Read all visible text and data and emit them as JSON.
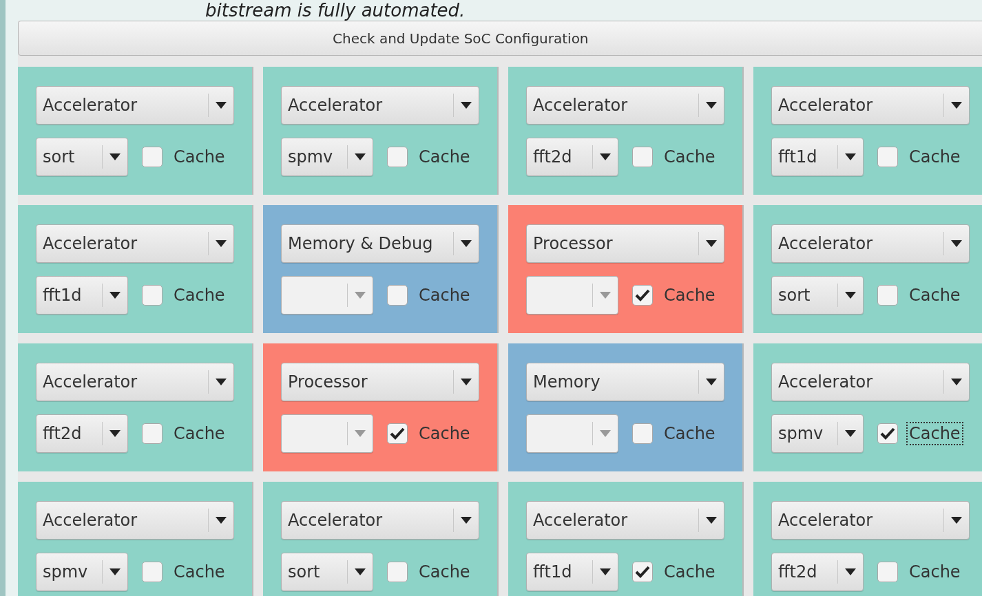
{
  "heading": "bitstream is fully automated.",
  "update_button": "Check and Update SoC Configuration",
  "tiles": [
    {
      "type": "Accelerator",
      "subtype": "sort",
      "cache_label": "Cache",
      "cache": false,
      "focused": false,
      "color": "#8dd3c7"
    },
    {
      "type": "Accelerator",
      "subtype": "spmv",
      "cache_label": "Cache",
      "cache": false,
      "focused": false,
      "color": "#8dd3c7"
    },
    {
      "type": "Accelerator",
      "subtype": "fft2d",
      "cache_label": "Cache",
      "cache": false,
      "focused": false,
      "color": "#8dd3c7"
    },
    {
      "type": "Accelerator",
      "subtype": "fft1d",
      "cache_label": "Cache",
      "cache": false,
      "focused": false,
      "color": "#8dd3c7"
    },
    {
      "type": "Accelerator",
      "subtype": "fft1d",
      "cache_label": "Cache",
      "cache": false,
      "focused": false,
      "color": "#8dd3c7"
    },
    {
      "type": "Memory & Debug",
      "cache_label": "Cache",
      "cache": false,
      "focused": false,
      "color": "#80b1d3"
    },
    {
      "type": "Processor",
      "cache_label": "Cache",
      "cache": true,
      "focused": false,
      "color": "#fb8072"
    },
    {
      "type": "Accelerator",
      "subtype": "sort",
      "cache_label": "Cache",
      "cache": false,
      "focused": false,
      "color": "#8dd3c7"
    },
    {
      "type": "Accelerator",
      "subtype": "fft2d",
      "cache_label": "Cache",
      "cache": false,
      "focused": false,
      "color": "#8dd3c7"
    },
    {
      "type": "Processor",
      "cache_label": "Cache",
      "cache": true,
      "focused": false,
      "color": "#fb8072"
    },
    {
      "type": "Memory",
      "cache_label": "Cache",
      "cache": false,
      "focused": false,
      "color": "#80b1d3"
    },
    {
      "type": "Accelerator",
      "subtype": "spmv",
      "cache_label": "Cache",
      "cache": true,
      "focused": true,
      "color": "#8dd3c7"
    },
    {
      "type": "Accelerator",
      "subtype": "spmv",
      "cache_label": "Cache",
      "cache": false,
      "focused": false,
      "color": "#8dd3c7"
    },
    {
      "type": "Accelerator",
      "subtype": "sort",
      "cache_label": "Cache",
      "cache": false,
      "focused": false,
      "color": "#8dd3c7"
    },
    {
      "type": "Accelerator",
      "subtype": "fft1d",
      "cache_label": "Cache",
      "cache": true,
      "focused": false,
      "color": "#8dd3c7"
    },
    {
      "type": "Accelerator",
      "subtype": "fft2d",
      "cache_label": "Cache",
      "cache": false,
      "focused": false,
      "color": "#8dd3c7"
    }
  ]
}
